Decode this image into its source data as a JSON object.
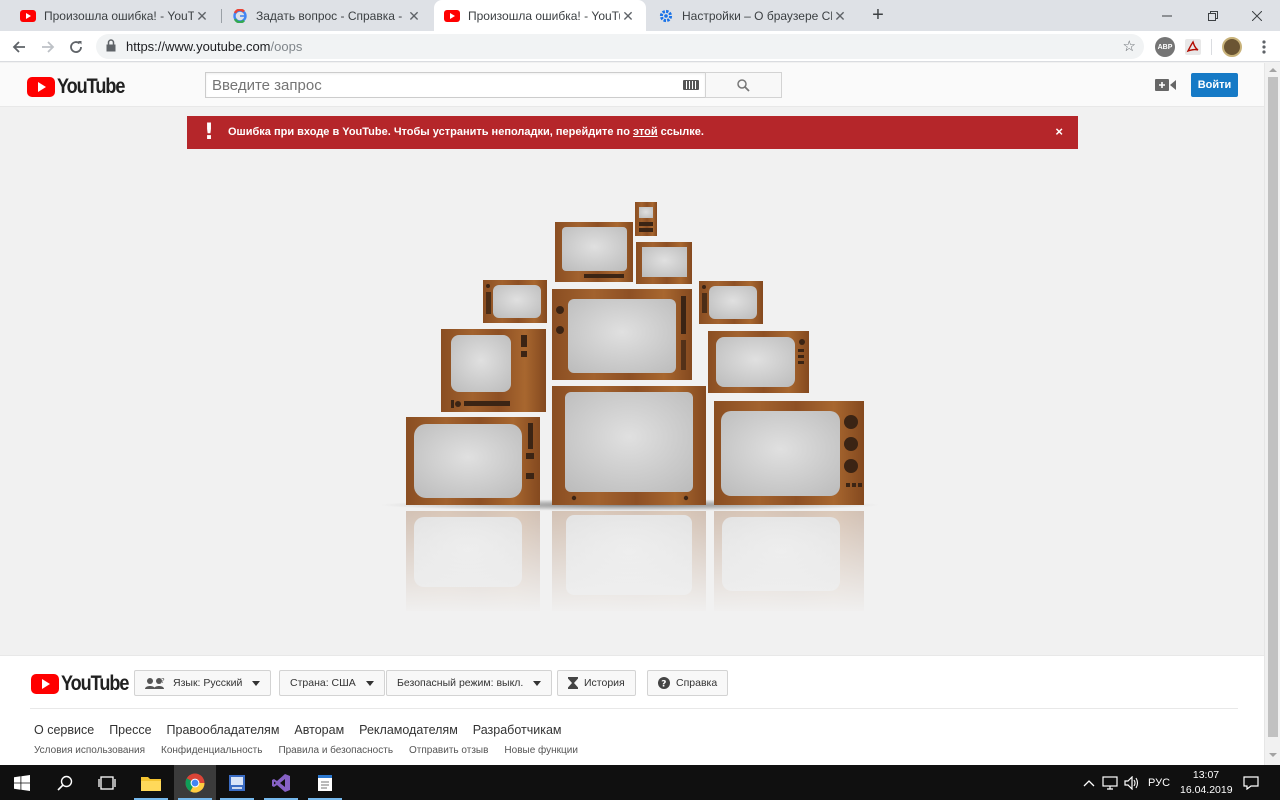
{
  "browser": {
    "tabs": [
      {
        "title": "Произошла ошибка! - YouTube",
        "favicon": "youtube-icon",
        "active": false
      },
      {
        "title": "Задать вопрос - Справка - YouTube",
        "favicon": "google-icon",
        "active": false
      },
      {
        "title": "Произошла ошибка! - YouTube",
        "favicon": "youtube-icon",
        "active": true
      },
      {
        "title": "Настройки – О браузере Chrome",
        "favicon": "settings-gear-icon",
        "active": false
      }
    ],
    "new_tab_label": "+",
    "address": {
      "host": "https://www.youtube.com",
      "path": "/oops"
    },
    "extensions": [
      {
        "name": "adblock-icon",
        "label": "ABP",
        "color": "#777777"
      },
      {
        "name": "acrobat-icon",
        "label": "",
        "color": "#b30b00"
      },
      {
        "name": "profile-avatar-icon",
        "label": "",
        "color": "#8a6d3b"
      }
    ]
  },
  "youtube": {
    "logo_text": "YouTube",
    "search_placeholder": "Введите запрос",
    "signin_label": "Войти",
    "alert": {
      "text_before_link": "Ошибка при входе в YouTube. Чтобы устранить неполадки, перейдите по ",
      "link_text": "этой",
      "text_after_link": " ссылке.",
      "close_label": "×",
      "color": "#b5262a"
    }
  },
  "footer": {
    "logo_text": "YouTube",
    "buttons": {
      "language": "Язык: Русский",
      "country": "Страна: США",
      "safety": "Безопасный режим: выкл.",
      "history": "История",
      "help": "Справка"
    },
    "primary_links": [
      "О сервисе",
      "Прессе",
      "Правообладателям",
      "Авторам",
      "Рекламодателям",
      "Разработчикам"
    ],
    "secondary_links": [
      "Условия использования",
      "Конфиденциальность",
      "Правила и безопасность",
      "Отправить отзыв",
      "Новые функции"
    ]
  },
  "taskbar": {
    "apps": [
      "start-icon",
      "search-icon",
      "task-view-icon",
      "file-explorer-icon",
      "chrome-icon",
      "app-icon",
      "visual-studio-icon",
      "notepad-icon"
    ],
    "language": "РУС",
    "time": "13:07",
    "date": "16.04.2019"
  },
  "colors": {
    "brand_red": "#ff0000",
    "signin_blue": "#167ac6",
    "wood": "#8b4f22"
  }
}
